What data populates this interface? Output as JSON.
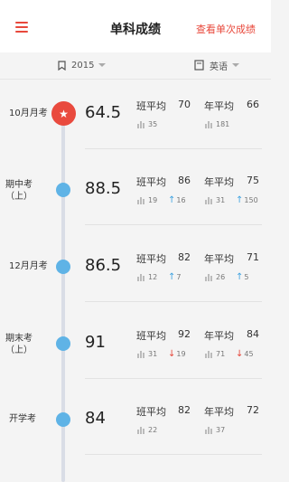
{
  "header": {
    "title": "单科成绩",
    "link": "查看单次成绩"
  },
  "filters": {
    "year": "2015",
    "subject": "英语"
  },
  "labels": {
    "class_avg": "班平均",
    "grade_avg": "年平均"
  },
  "exams": [
    {
      "name": "10月月考",
      "score": "64.5",
      "class_avg": "70",
      "class_rank": "35",
      "class_change": "",
      "grade_avg": "66",
      "grade_rank": "181",
      "grade_change": "",
      "current": true
    },
    {
      "name": "期中考\n（上）",
      "score": "88.5",
      "class_avg": "86",
      "class_rank": "19",
      "class_change": "16",
      "class_dir": "up",
      "grade_avg": "75",
      "grade_rank": "31",
      "grade_change": "150",
      "grade_dir": "up"
    },
    {
      "name": "12月月考",
      "score": "86.5",
      "class_avg": "82",
      "class_rank": "12",
      "class_change": "7",
      "class_dir": "up",
      "grade_avg": "71",
      "grade_rank": "26",
      "grade_change": "5",
      "grade_dir": "up"
    },
    {
      "name": "期末考\n（上）",
      "score": "91",
      "class_avg": "92",
      "class_rank": "31",
      "class_change": "19",
      "class_dir": "down",
      "grade_avg": "84",
      "grade_rank": "71",
      "grade_change": "45",
      "grade_dir": "down"
    },
    {
      "name": "开学考",
      "score": "84",
      "class_avg": "82",
      "class_rank": "22",
      "class_change": "",
      "grade_avg": "72",
      "grade_rank": "37",
      "grade_change": ""
    }
  ]
}
